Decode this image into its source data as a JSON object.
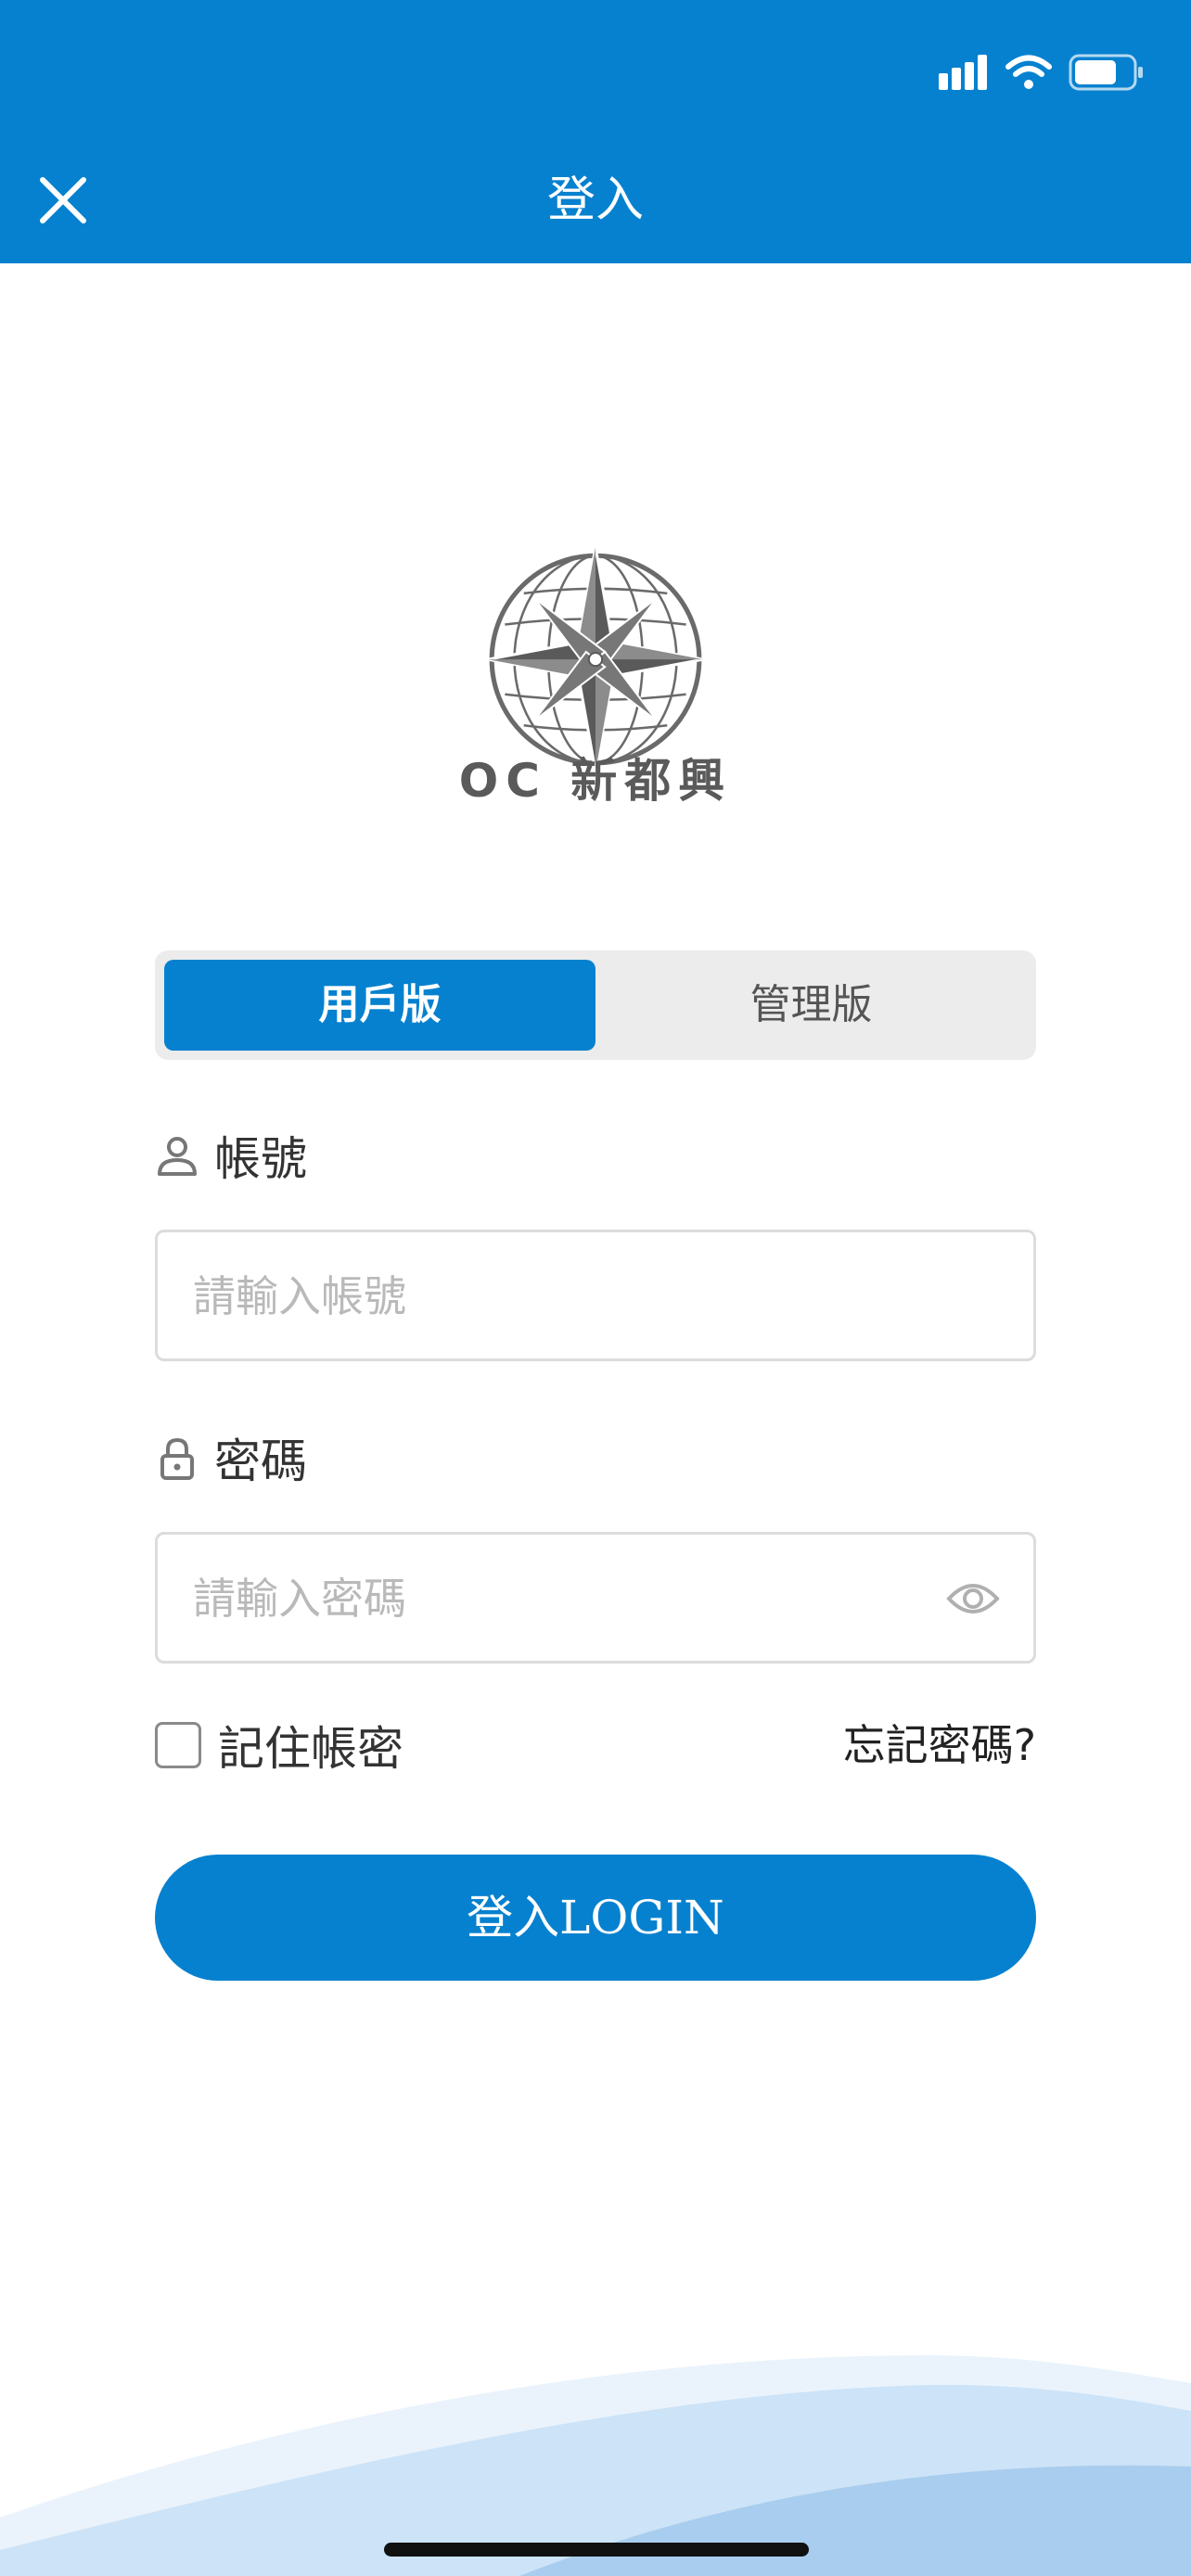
{
  "nav": {
    "title": "登入",
    "close_icon": "close-icon"
  },
  "status_bar": {
    "icons": [
      "cellular-signal-icon",
      "wifi-icon",
      "battery-icon"
    ]
  },
  "brand": {
    "text": "OC 新都興",
    "logo_icon": "compass-rose-globe-logo"
  },
  "segment": {
    "options": [
      "用戶版",
      "管理版"
    ],
    "selected": "用戶版"
  },
  "account": {
    "label": "帳號",
    "placeholder": "請輸入帳號",
    "value": "",
    "icon": "user-icon"
  },
  "password": {
    "label": "密碼",
    "placeholder": "請輸入密碼",
    "value": "",
    "icon": "lock-icon",
    "toggle_icon": "eye-icon"
  },
  "remember": {
    "label": "記住帳密",
    "checked": false
  },
  "forgot": {
    "label": "忘記密碼?"
  },
  "login": {
    "label": "登入LOGIN"
  },
  "colors": {
    "primary": "#0681CF",
    "segment_bg": "#ECECEC",
    "placeholder": "#B9B9B9"
  }
}
